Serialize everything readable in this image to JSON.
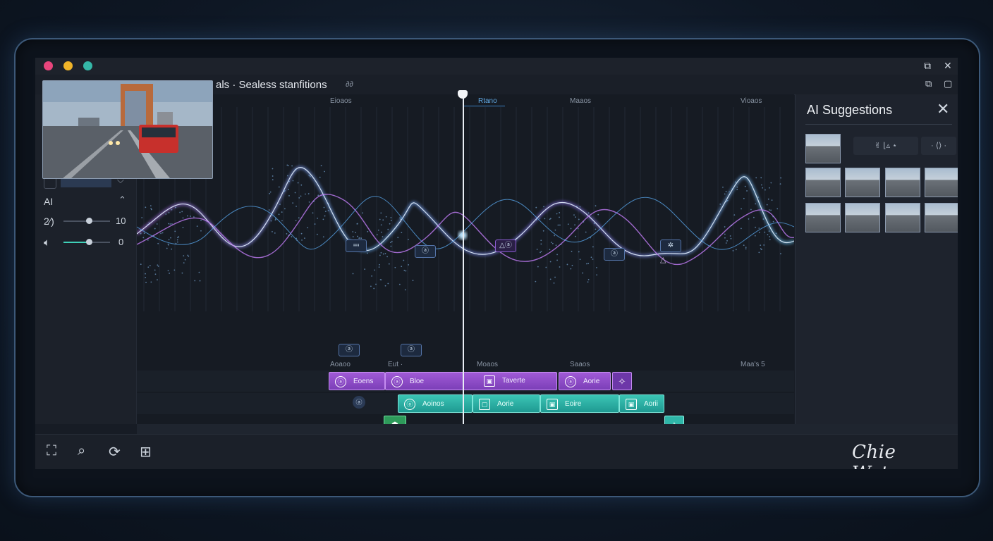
{
  "window": {
    "title": "als · Sealess stanfitions",
    "title_suffix": "∂∂"
  },
  "colors": {
    "close_dot": "#e8457c",
    "min_dot": "#f0b429",
    "max_dot": "#35b8a8",
    "accent_purple": "#8e4fd0",
    "accent_teal": "#2fb6a8"
  },
  "left_panel": {
    "ai_label": "AI",
    "row1_label": "2⁄)",
    "row1_value": "10",
    "row1_level": 0.55,
    "row2_value": "0",
    "row2_level": 0.55
  },
  "ruler": {
    "top_labels": [
      "Eioaos",
      "Rtano",
      "Maaos",
      "Vioaos"
    ],
    "mid_labels": [
      "Aoaoo",
      "Eut ·",
      "Moaos",
      "Saaos",
      "Maa's 5"
    ]
  },
  "markers": {
    "top": [
      "≕",
      "ⓐ",
      "△ⓐ",
      "ⓐ",
      "✲"
    ],
    "low": [
      "ⓐ",
      "ⓐ",
      "△"
    ]
  },
  "clips": {
    "purple": [
      {
        "label": "Eoens",
        "icon": "ⓐ"
      },
      {
        "label": "Bloe",
        "icon": "ⓐ"
      },
      {
        "label": "Taverte",
        "icon": "▣"
      },
      {
        "label": "Aorie",
        "icon": "ⓐ"
      }
    ],
    "teal": [
      {
        "label": "Aoinos",
        "icon": "ⓐ"
      },
      {
        "label": "Aorie",
        "icon": "▢"
      },
      {
        "label": "Eoire",
        "icon": "▣"
      },
      {
        "label": "Aorii",
        "icon": "▣"
      }
    ],
    "purple_end_icon": "✧",
    "teal_start_icon": "☗",
    "teal_end_icon": "✧",
    "link_icon": "ⓐ"
  },
  "ai_panel": {
    "title": "AI Suggestions",
    "toolbar_a": "✌  ⌊▵  ⋆",
    "toolbar_b": "· ⟨⟩ ·"
  },
  "bottom_bar": {
    "icons": [
      "fullscreen-icon",
      "zoom-icon",
      "refresh-icon",
      "grid-icon"
    ],
    "signature": "Chie Waters"
  }
}
